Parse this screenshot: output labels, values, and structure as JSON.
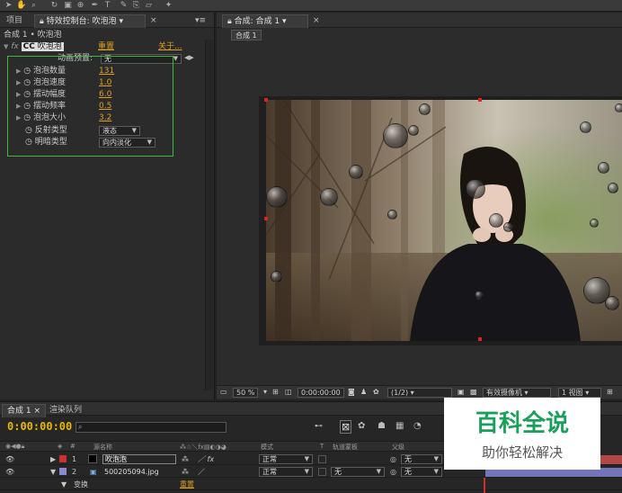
{
  "toolbar": {
    "icons": [
      "selection-tool",
      "hand-tool",
      "zoom-tool",
      "rotate-tool",
      "camera-tool",
      "pan-behind-tool",
      "pen-tool",
      "text-tool",
      "brush-tool",
      "clone-tool",
      "eraser-tool",
      "puppet-tool"
    ]
  },
  "left_panel": {
    "tabs": {
      "project": "项目",
      "effect_controls": "特效控制台: 吹泡泡",
      "close": "×"
    },
    "breadcrumb": "合成 1 • 吹泡泡",
    "effect": {
      "name": "吹泡泡",
      "prefix": "CC",
      "reset": "重置",
      "about": "关于..."
    },
    "animation_preset": {
      "label": "动画预置:",
      "value": "无"
    },
    "params": [
      {
        "name": "泡泡数量",
        "value": "131"
      },
      {
        "name": "泡泡速度",
        "value": "1.0"
      },
      {
        "name": "摆动幅度",
        "value": "6.0"
      },
      {
        "name": "摆动频率",
        "value": "0.5"
      },
      {
        "name": "泡泡大小",
        "value": "3.2"
      }
    ],
    "reflection": {
      "label": "反射类型",
      "value": "液态"
    },
    "shading": {
      "label": "明暗类型",
      "value": "向内淡化"
    }
  },
  "right_panel": {
    "tab": "合成: 合成 1",
    "close": "×",
    "comp_button": "合成 1",
    "viewer_bar": {
      "zoom": "50 %",
      "timecode": "0:00:00:00",
      "resolution": "(1/2)",
      "camera": "有效摄像机",
      "views": "1 视图"
    }
  },
  "timeline": {
    "tabs": {
      "comp": "合成 1",
      "render": "渲染队列"
    },
    "time": "0:00:00:00",
    "search_placeholder": "",
    "columns": {
      "source": "源名称",
      "mode": "模式",
      "t": "T",
      "trkmat": "轨道蒙板",
      "parent": "父级"
    },
    "layers": [
      {
        "index": "1",
        "name": "吹泡泡",
        "color": "#c83232",
        "mode": "正常",
        "parent": "无"
      },
      {
        "index": "2",
        "name": "500205094.jpg",
        "color": "#8a8ad0",
        "mode": "正常",
        "trkmat": "无",
        "parent": "无"
      }
    ],
    "transform_row": {
      "label": "变换",
      "reset": "重置"
    }
  },
  "watermark": {
    "title": "百科全说",
    "subtitle": "助你轻松解决"
  },
  "colors": {
    "accent_orange": "#e0a020",
    "timecode_yellow": "#e6b800",
    "highlight_green": "#3db83d",
    "watermark_green": "#1aa05a"
  }
}
